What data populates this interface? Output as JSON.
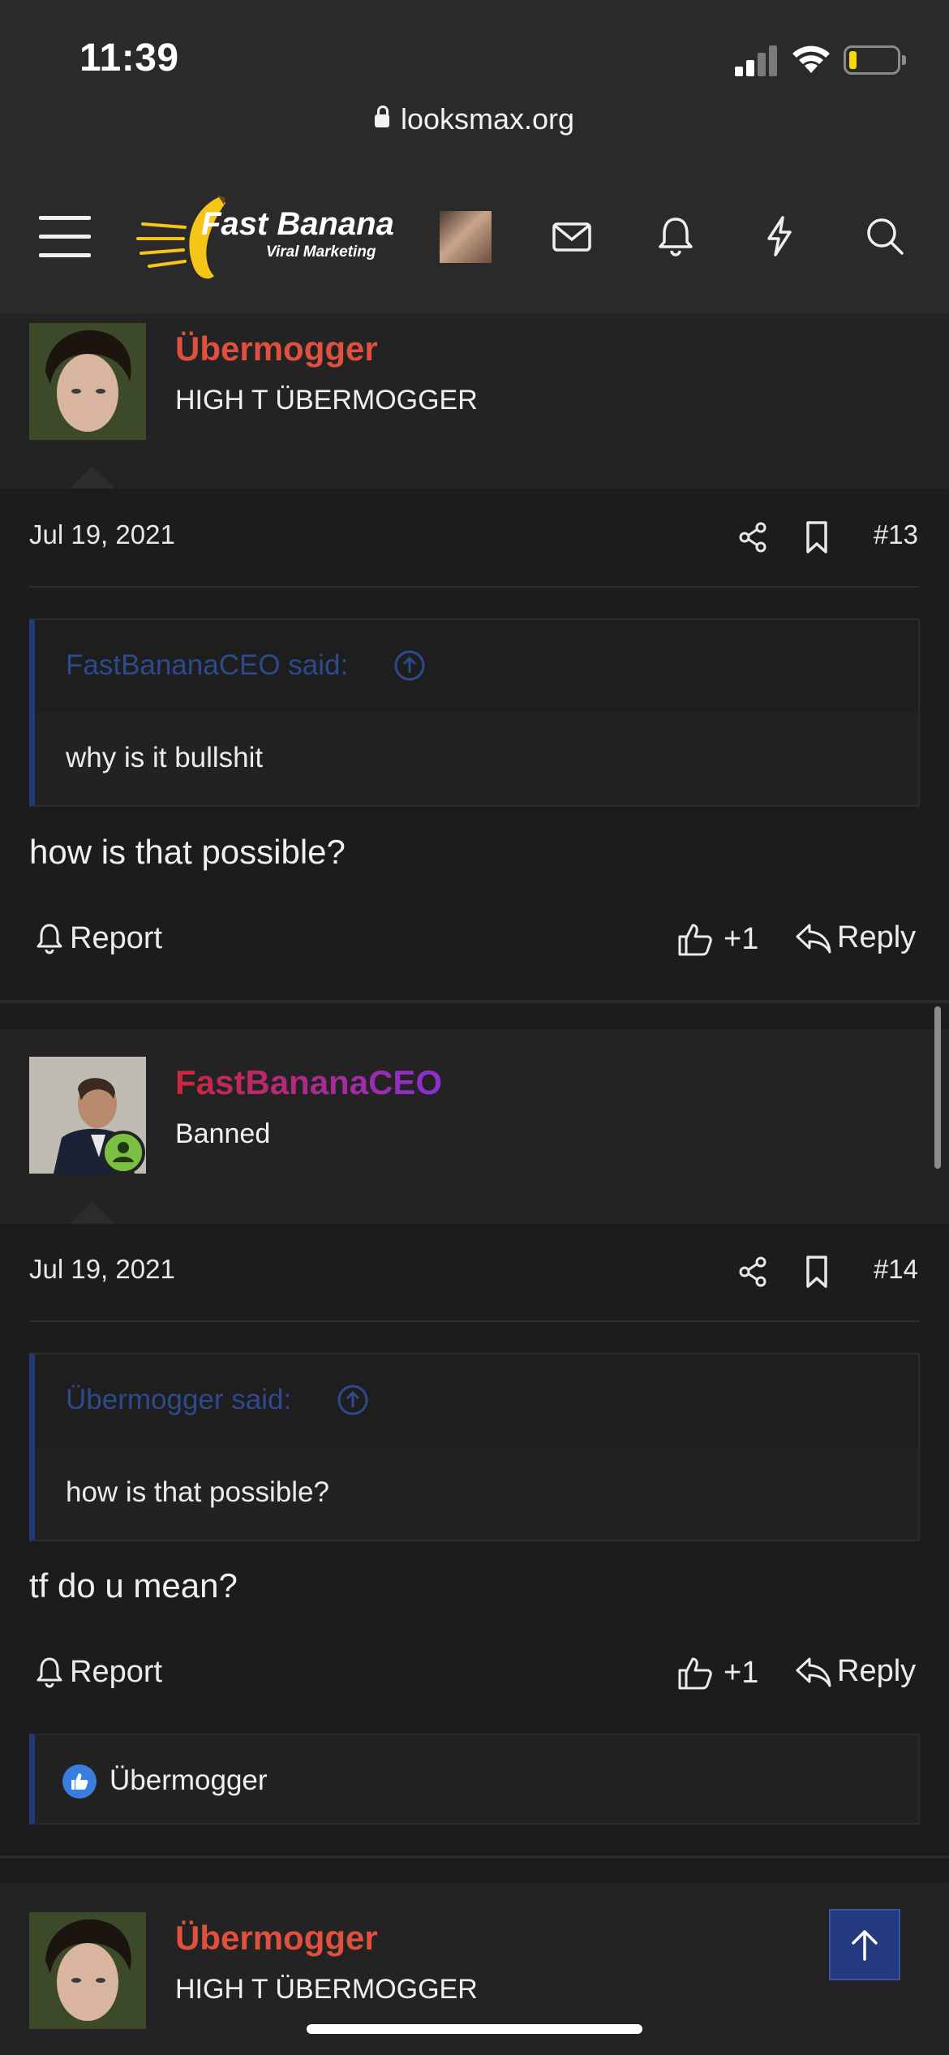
{
  "status_bar": {
    "time": "11:39"
  },
  "browser": {
    "url": "looksmax.org"
  },
  "header": {
    "logo_line1": "Fast Banana",
    "logo_line2": "Viral Marketing"
  },
  "posts": [
    {
      "username": "Übermogger",
      "user_title": "HIGH T ÜBERMOGGER",
      "date": "Jul 19, 2021",
      "number": "#13",
      "quote_author": "FastBananaCEO said:",
      "quote_text": "why is it bullshit",
      "body": "how is that possible?",
      "report_label": "Report",
      "like_count": "+1",
      "reply_label": "Reply"
    },
    {
      "username": "FastBananaCEO",
      "user_title": "Banned",
      "date": "Jul 19, 2021",
      "number": "#14",
      "quote_author": "Übermogger said:",
      "quote_text": "how is that possible?",
      "body": "tf do u mean?",
      "report_label": "Report",
      "like_count": "+1",
      "reply_label": "Reply",
      "reactions_by": "Übermogger"
    },
    {
      "username": "Übermogger",
      "user_title": "HIGH T ÜBERMOGGER"
    }
  ],
  "colors": {
    "username_red": "#e0503e",
    "quote_author_blue": "#2e4a8c",
    "quote_border": "#233a78",
    "online_badge": "#7cc043",
    "banana_yellow": "#f5c518"
  }
}
